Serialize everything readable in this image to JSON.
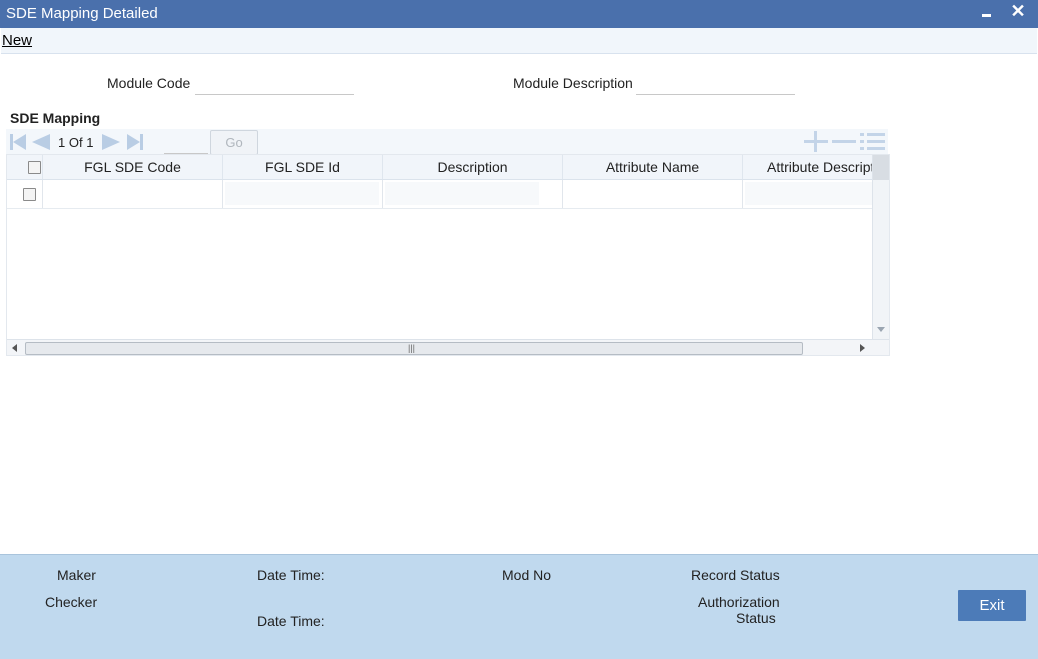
{
  "window": {
    "title": "SDE Mapping Detailed",
    "minimize_icon": "minimize-icon",
    "close_icon": "close-icon",
    "close_glyph": "✕"
  },
  "menu": {
    "new_label": "New"
  },
  "form": {
    "module_code_label": "Module Code",
    "module_code_value": "",
    "module_description_label": "Module Description",
    "module_description_value": ""
  },
  "section": {
    "title": "SDE Mapping"
  },
  "pager": {
    "current": "1",
    "of_label": "Of",
    "total": "1",
    "goto_value": "",
    "go_label": "Go"
  },
  "grid": {
    "columns": [
      "FGL SDE Code",
      "FGL SDE Id",
      "Description",
      "Attribute Name",
      "Attribute Description"
    ],
    "rows": [
      [
        "",
        "",
        "",
        "",
        ""
      ]
    ]
  },
  "footer": {
    "maker_label": "Maker",
    "checker_label": "Checker",
    "date_time_label_1": "Date Time:",
    "date_time_label_2": "Date Time:",
    "mod_no_label": "Mod No",
    "record_status_label": "Record Status",
    "authorization_label": "Authorization",
    "status_label": "Status",
    "exit_label": "Exit"
  },
  "colors": {
    "titlebar": "#4a70ac",
    "footer": "#c0d9ee",
    "exit_button": "#4c7bb8"
  }
}
